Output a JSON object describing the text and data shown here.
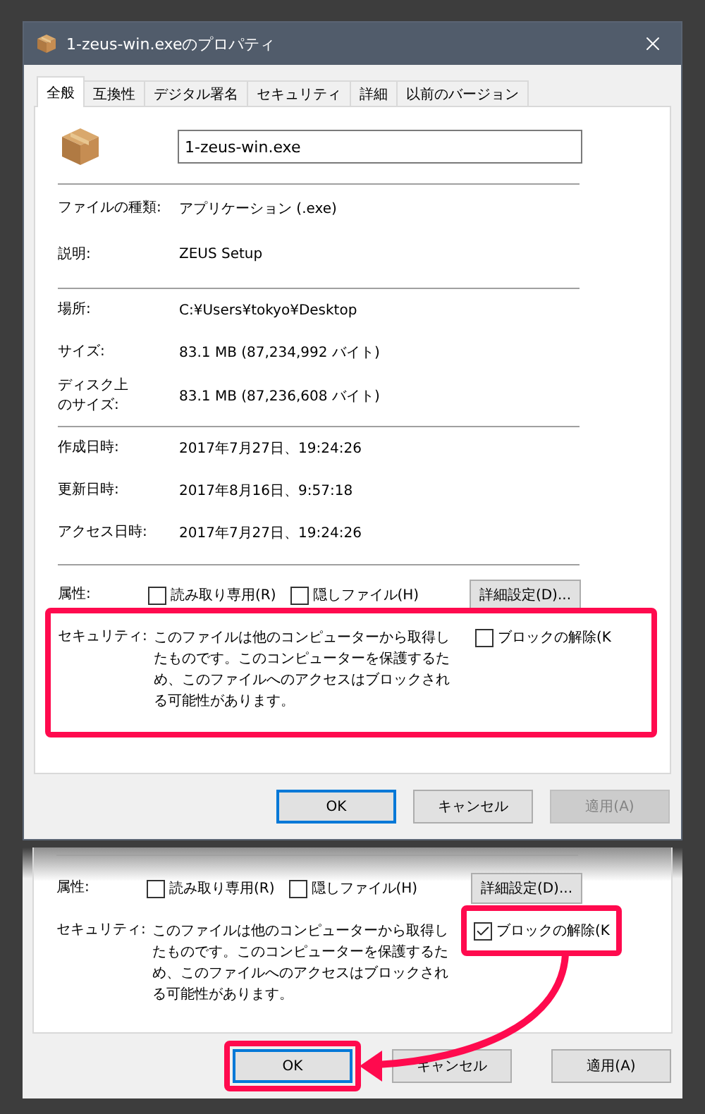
{
  "window": {
    "title": "1-zeus-win.exeのプロパティ"
  },
  "tabs": [
    {
      "label": "全般",
      "selected": true
    },
    {
      "label": "互換性",
      "selected": false
    },
    {
      "label": "デジタル署名",
      "selected": false
    },
    {
      "label": "セキュリティ",
      "selected": false
    },
    {
      "label": "詳細",
      "selected": false
    },
    {
      "label": "以前のバージョン",
      "selected": false
    }
  ],
  "file_name": "1-zeus-win.exe",
  "property_groups": [
    [
      {
        "label": "ファイルの種類:",
        "value": "アプリケーション (.exe)"
      },
      {
        "label": "説明:",
        "value": "ZEUS Setup"
      }
    ],
    [
      {
        "label": "場所:",
        "value": "C:¥Users¥tokyo¥Desktop"
      },
      {
        "label": "サイズ:",
        "value": "83.1 MB (87,234,992 バイト)"
      },
      {
        "label": [
          "ディスク上",
          "のサイズ:"
        ],
        "value": "83.1 MB (87,236,608 バイト)"
      }
    ],
    [
      {
        "label": "作成日時:",
        "value": "2017年7月27日、19:24:26"
      },
      {
        "label": "更新日時:",
        "value": "2017年8月16日、9:57:18"
      },
      {
        "label": "アクセス日時:",
        "value": "2017年7月27日、19:24:26"
      }
    ]
  ],
  "attributes": {
    "label": "属性:",
    "options": [
      {
        "label": "読み取り専用(R)",
        "checked": false
      },
      {
        "label": "隠しファイル(H)",
        "checked": false
      }
    ],
    "advanced_button": "詳細設定(D)..."
  },
  "security": {
    "label": "セキュリティ:",
    "message": "このファイルは他のコンピューターから取得したものです。このコンピューターを保護するため、このファイルへのアクセスはブロックされる可能性があります。",
    "highlighted": true,
    "unblock": {
      "label": "ブロックの解除(K",
      "checked": false,
      "highlighted": false
    }
  },
  "buttons": [
    {
      "label": "OK",
      "default": true,
      "disabled": false,
      "highlighted": false
    },
    {
      "label": "キャンセル",
      "default": false,
      "disabled": false,
      "highlighted": false
    },
    {
      "label": "適用(A)",
      "default": false,
      "disabled": true,
      "highlighted": false
    }
  ],
  "excerpt": {
    "attributes": {
      "label": "属性:",
      "options": [
        {
          "label": "読み取り専用(R)",
          "checked": false
        },
        {
          "label": "隠しファイル(H)",
          "checked": false
        }
      ],
      "advanced_button": "詳細設定(D)..."
    },
    "security": {
      "label": "セキュリティ:",
      "message": "このファイルは他のコンピューターから取得したものです。このコンピューターを保護するため、このファイルへのアクセスはブロックされる可能性があります。",
      "highlighted": false,
      "unblock": {
        "label": "ブロックの解除(K",
        "checked": true,
        "highlighted": true
      }
    },
    "buttons": [
      {
        "label": "OK",
        "default": true,
        "disabled": false,
        "highlighted": true
      },
      {
        "label": "キャンセル",
        "default": false,
        "disabled": false,
        "highlighted": false
      },
      {
        "label": "適用(A)",
        "default": false,
        "disabled": false,
        "highlighted": false
      }
    ]
  }
}
